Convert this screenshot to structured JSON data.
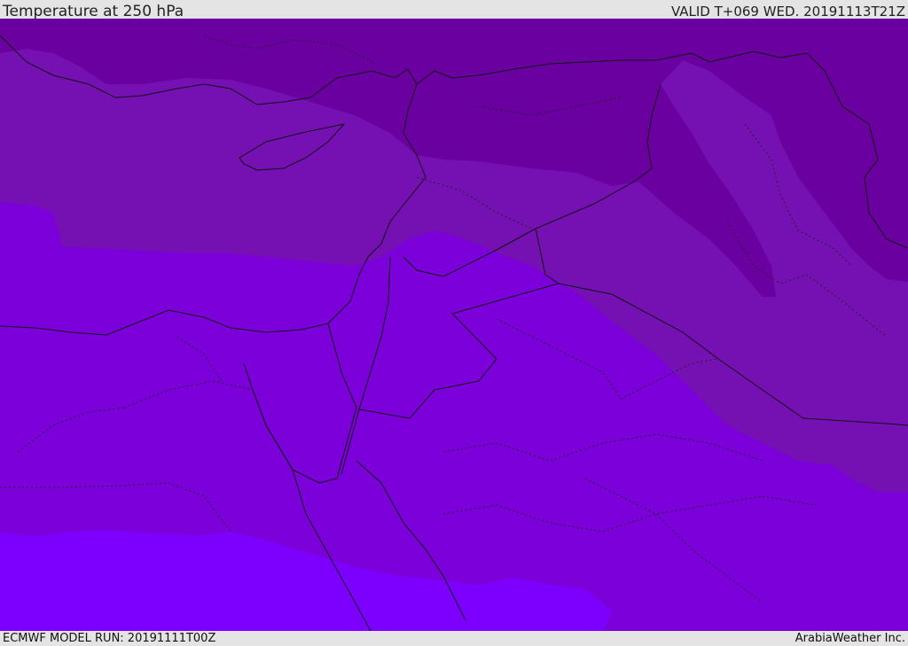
{
  "header": {
    "title": "Temperature at 250 hPa",
    "valid_time": "VALID T+069 WED. 20191113T21Z"
  },
  "footer": {
    "model_run": "ECMWF MODEL RUN: 20191111T00Z",
    "credit": "ArabiaWeather Inc."
  },
  "map": {
    "colors": {
      "band_darkest": "#6a009f",
      "band_dark": "#7510b2",
      "band_mid": "#7c00d9",
      "band_light": "#7d00ff",
      "borders": "#111111"
    }
  }
}
